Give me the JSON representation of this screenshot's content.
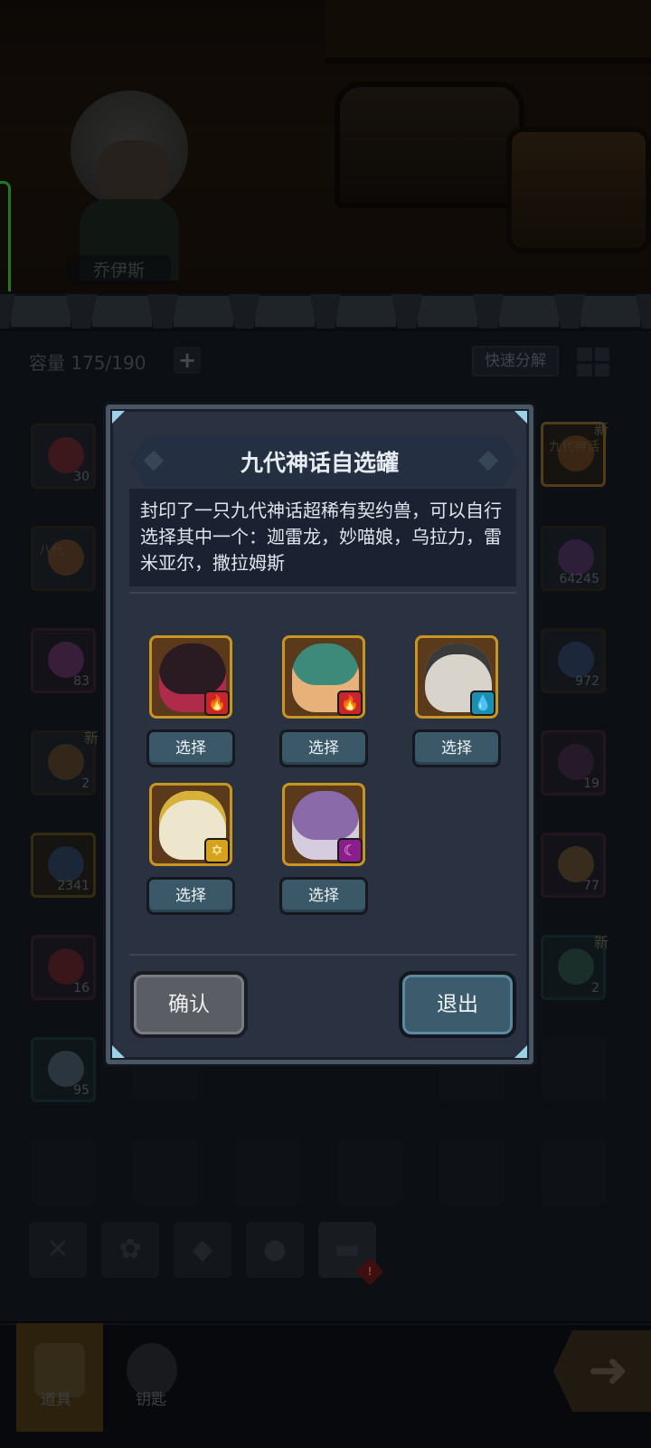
{
  "scene": {
    "hero_name": "乔伊斯"
  },
  "inventory": {
    "capacity_label": "容量 175/190",
    "add_symbol": "+",
    "quick_decompose_label": "快速分解",
    "left_column": [
      {
        "count": "30",
        "color": "#c0303a",
        "text": ""
      },
      {
        "count": "",
        "color": "#b36a2a",
        "text": "八代"
      },
      {
        "count": "83",
        "color": "#b24fa6",
        "text": ""
      },
      {
        "count": "2",
        "color": "#9a6a2a",
        "text": "",
        "new": "新"
      },
      {
        "count": "2341",
        "color": "#3a6ab0",
        "text": ""
      },
      {
        "count": "16",
        "color": "#b03030",
        "text": ""
      },
      {
        "count": "95",
        "color": "#8aa0b8",
        "text": ""
      }
    ],
    "right_column": [
      {
        "count": "",
        "color": "#b36a2a",
        "text": "九代神话",
        "new": "新"
      },
      {
        "count": "64245",
        "color": "#8a4aa8",
        "text": ""
      },
      {
        "count": "972",
        "color": "#4a6ab0",
        "text": ""
      },
      {
        "count": "19",
        "color": "#6a3a6a",
        "text": ""
      },
      {
        "count": "77",
        "color": "#b08a3a",
        "text": ""
      },
      {
        "count": "2",
        "color": "#4a8a6a",
        "text": "",
        "new": "新"
      }
    ]
  },
  "nav": {
    "items_label": "道具",
    "keys_label": "钥匙"
  },
  "modal": {
    "title": "九代神话自选罐",
    "description": "封印了一只九代神话超稀有契约兽，可以自行选择其中一个：迦雷龙，妙喵娘，乌拉力，雷米亚尔，撒拉姆斯",
    "pets": [
      {
        "select_label": "选择",
        "art_color": "#2a1a22",
        "element": "fire",
        "element_color": "#c8252a",
        "element_glyph": "🔥"
      },
      {
        "select_label": "选择",
        "art_color": "#3e8a7a",
        "element": "fire",
        "element_color": "#c8252a",
        "element_glyph": "🔥"
      },
      {
        "select_label": "选择",
        "art_color": "#d8d4cc",
        "element": "water",
        "element_color": "#1b8fb0",
        "element_glyph": "💧"
      },
      {
        "select_label": "选择",
        "art_color": "#eee6cc",
        "element": "light",
        "element_color": "#d6a21c",
        "element_glyph": "✡"
      },
      {
        "select_label": "选择",
        "art_color": "#8a6aa8",
        "element": "dark",
        "element_color": "#8a1e8a",
        "element_glyph": "☾"
      }
    ],
    "confirm_label": "确认",
    "exit_label": "退出"
  }
}
